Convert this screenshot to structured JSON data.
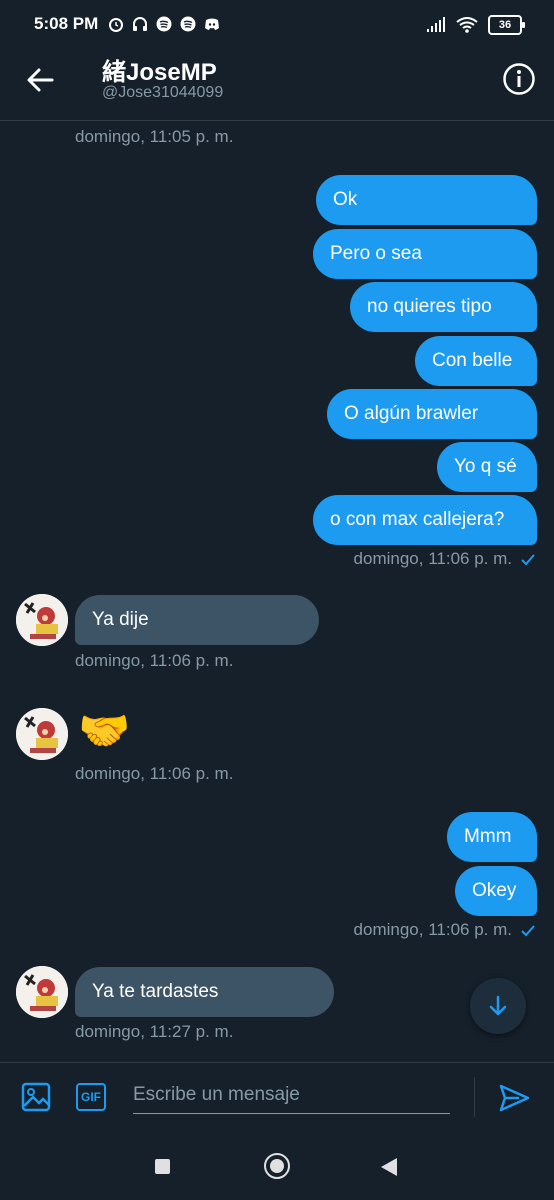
{
  "status_bar": {
    "time": "5:08 PM",
    "battery": "36"
  },
  "header": {
    "title": "緒JoseMP",
    "handle": "@Jose31044099"
  },
  "messages": {
    "ts_top": "domingo, 11:05 p. m.",
    "out1": [
      "Ok",
      "Pero o sea",
      "no quieres tipo",
      "Con belle",
      "O algún brawler",
      "Yo q sé",
      "o con max callejera?"
    ],
    "ts_out1": "domingo, 11:06 p. m.",
    "in1": "Ya dije",
    "ts_in1": "domingo, 11:06 p. m.",
    "in2_emoji": "🤝",
    "ts_in2": "domingo, 11:06 p. m.",
    "out2": [
      "Mmm",
      "Okey"
    ],
    "ts_out2": "domingo, 11:06 p. m.",
    "in3": "Ya te tardastes",
    "ts_in3": "domingo, 11:27 p. m."
  },
  "composer": {
    "placeholder": "Escribe un mensaje",
    "gif_label": "GIF"
  },
  "colors": {
    "background": "#15202b",
    "accent": "#1d9bf0",
    "incoming_bubble": "#3d5466",
    "muted_text": "#8899a6"
  }
}
